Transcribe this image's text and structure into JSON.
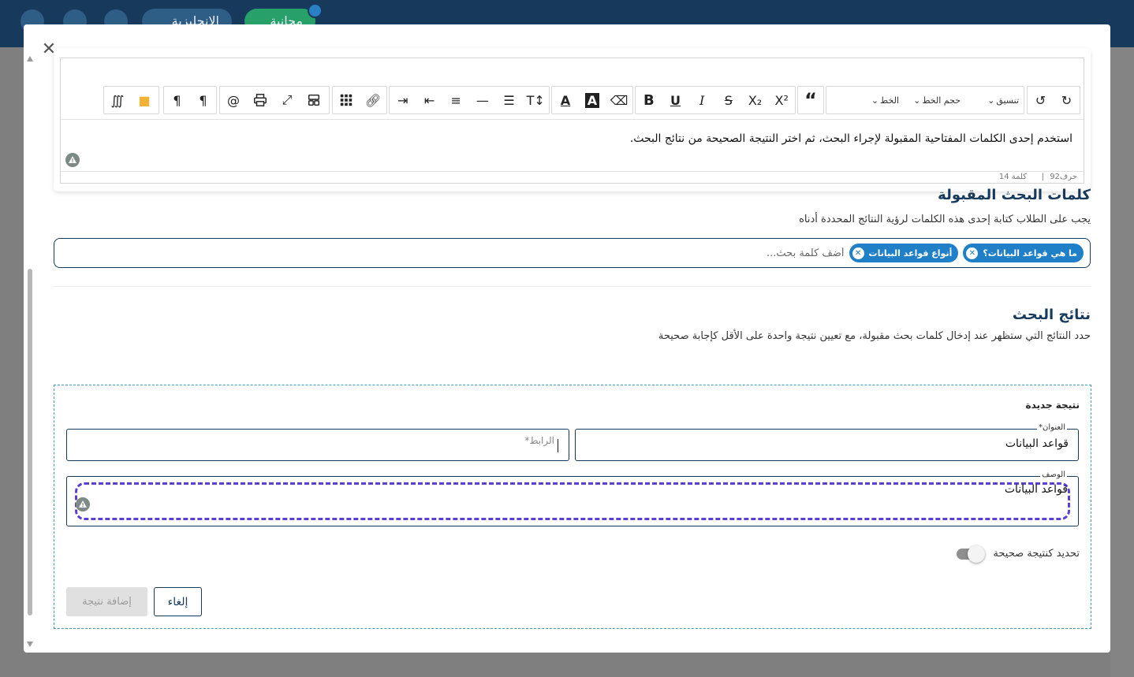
{
  "app_header": {
    "language_button": "الإنجليزية",
    "plan_badge": "مجانية"
  },
  "modal": {
    "close_symbol": "✕"
  },
  "editor": {
    "toolbar": {
      "font_select": "الخط",
      "font_size_select": "حجم الخط",
      "format_select": "تنسيق"
    },
    "content": "استخدم إحدى الكلمات المفتاحية المقبولة لإجراء البحث، ثم اختر النتيجة الصحيحة من نتائج البحث.",
    "stats": {
      "chars": "حرف92",
      "separator": "|",
      "words": "كلمة 14"
    }
  },
  "keywords": {
    "title": "كلمات البحث المقبولة",
    "subtitle": "يجب على الطلاب كتابة إحدى هذه الكلمات لرؤية النتائج المحددة أدناه",
    "chips": [
      {
        "label": "ما هي قواعد البيانات؟",
        "remove": "✕"
      },
      {
        "label": "أنواع قواعد البيانات",
        "remove": "✕"
      }
    ],
    "input_placeholder": "أضف كلمة بحث..."
  },
  "results": {
    "title": "نتائج البحث",
    "subtitle": "حدد النتائج التي ستظهر عند إدخال كلمات بحث مقبولة، مع تعيين نتيجة واحدة على الأقل كإجابة صحيحة"
  },
  "new_result": {
    "heading": "نتيجة جديدة",
    "title_field": {
      "label": "العنوان*",
      "value": "قواعد البيانات"
    },
    "link_field": {
      "label": "الرابط*",
      "value": ""
    },
    "description_field": {
      "label": "الوصف",
      "value": "قواعد البيانات"
    },
    "correct_toggle": {
      "label": "تحديد كنتيجة صحيحة",
      "checked": false
    },
    "cancel_button": "إلغاء",
    "add_button": "إضافة نتيجة"
  },
  "colors": {
    "primary": "#173a5c",
    "chip": "#1f7fc7",
    "dashed_focus": "#5b3fd3",
    "result_border": "#3a9bb5"
  }
}
